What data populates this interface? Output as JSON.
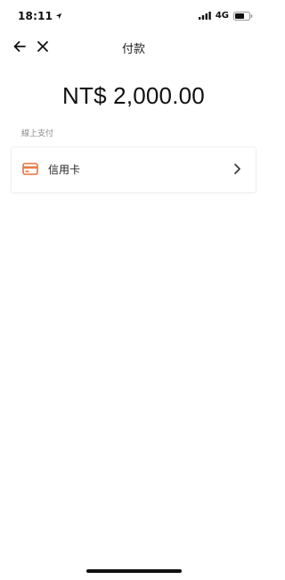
{
  "status_bar": {
    "time": "18:11",
    "network": "4G",
    "icons": [
      "location-arrow-icon",
      "signal-icon",
      "battery-icon"
    ]
  },
  "nav": {
    "title": "付款",
    "back_icon": "arrow-left-icon",
    "close_icon": "close-icon"
  },
  "payment": {
    "amount": "NT$ 2,000.00",
    "section_label": "線上支付",
    "methods": [
      {
        "label": "信用卡",
        "icon": "credit-card-icon",
        "icon_color": "#E8743B"
      }
    ]
  },
  "colors": {
    "accent": "#E8743B",
    "text": "#111111",
    "muted": "#8A8A8A"
  }
}
